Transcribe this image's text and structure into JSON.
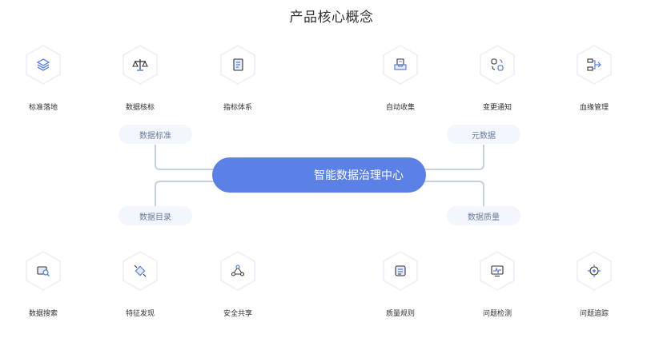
{
  "title": "产品核心概念",
  "core": "智能数据治理中心",
  "pills": {
    "top_left": "数据标准",
    "top_right": "元数据",
    "bottom_left": "数据目录",
    "bottom_right": "数据质量"
  },
  "features_top": [
    {
      "label": "标准落地",
      "icon": "layers-icon"
    },
    {
      "label": "数据核标",
      "icon": "scale-icon"
    },
    {
      "label": "指标体系",
      "icon": "index-book-icon"
    },
    {
      "label": "自动收集",
      "icon": "inbox-collect-icon"
    },
    {
      "label": "变更通知",
      "icon": "change-notify-icon"
    },
    {
      "label": "血缘管理",
      "icon": "lineage-icon"
    }
  ],
  "features_bottom": [
    {
      "label": "数据搜索",
      "icon": "data-search-icon"
    },
    {
      "label": "特征发现",
      "icon": "feature-discovery-icon"
    },
    {
      "label": "安全共享",
      "icon": "share-network-icon"
    },
    {
      "label": "质量规则",
      "icon": "quality-rule-icon"
    },
    {
      "label": "问题检测",
      "icon": "monitor-detect-icon"
    },
    {
      "label": "问题追踪",
      "icon": "target-track-icon"
    }
  ],
  "colors": {
    "accent": "#5b80e6",
    "pill_bg": "#f3f6fd",
    "line": "#c5d0e0"
  }
}
